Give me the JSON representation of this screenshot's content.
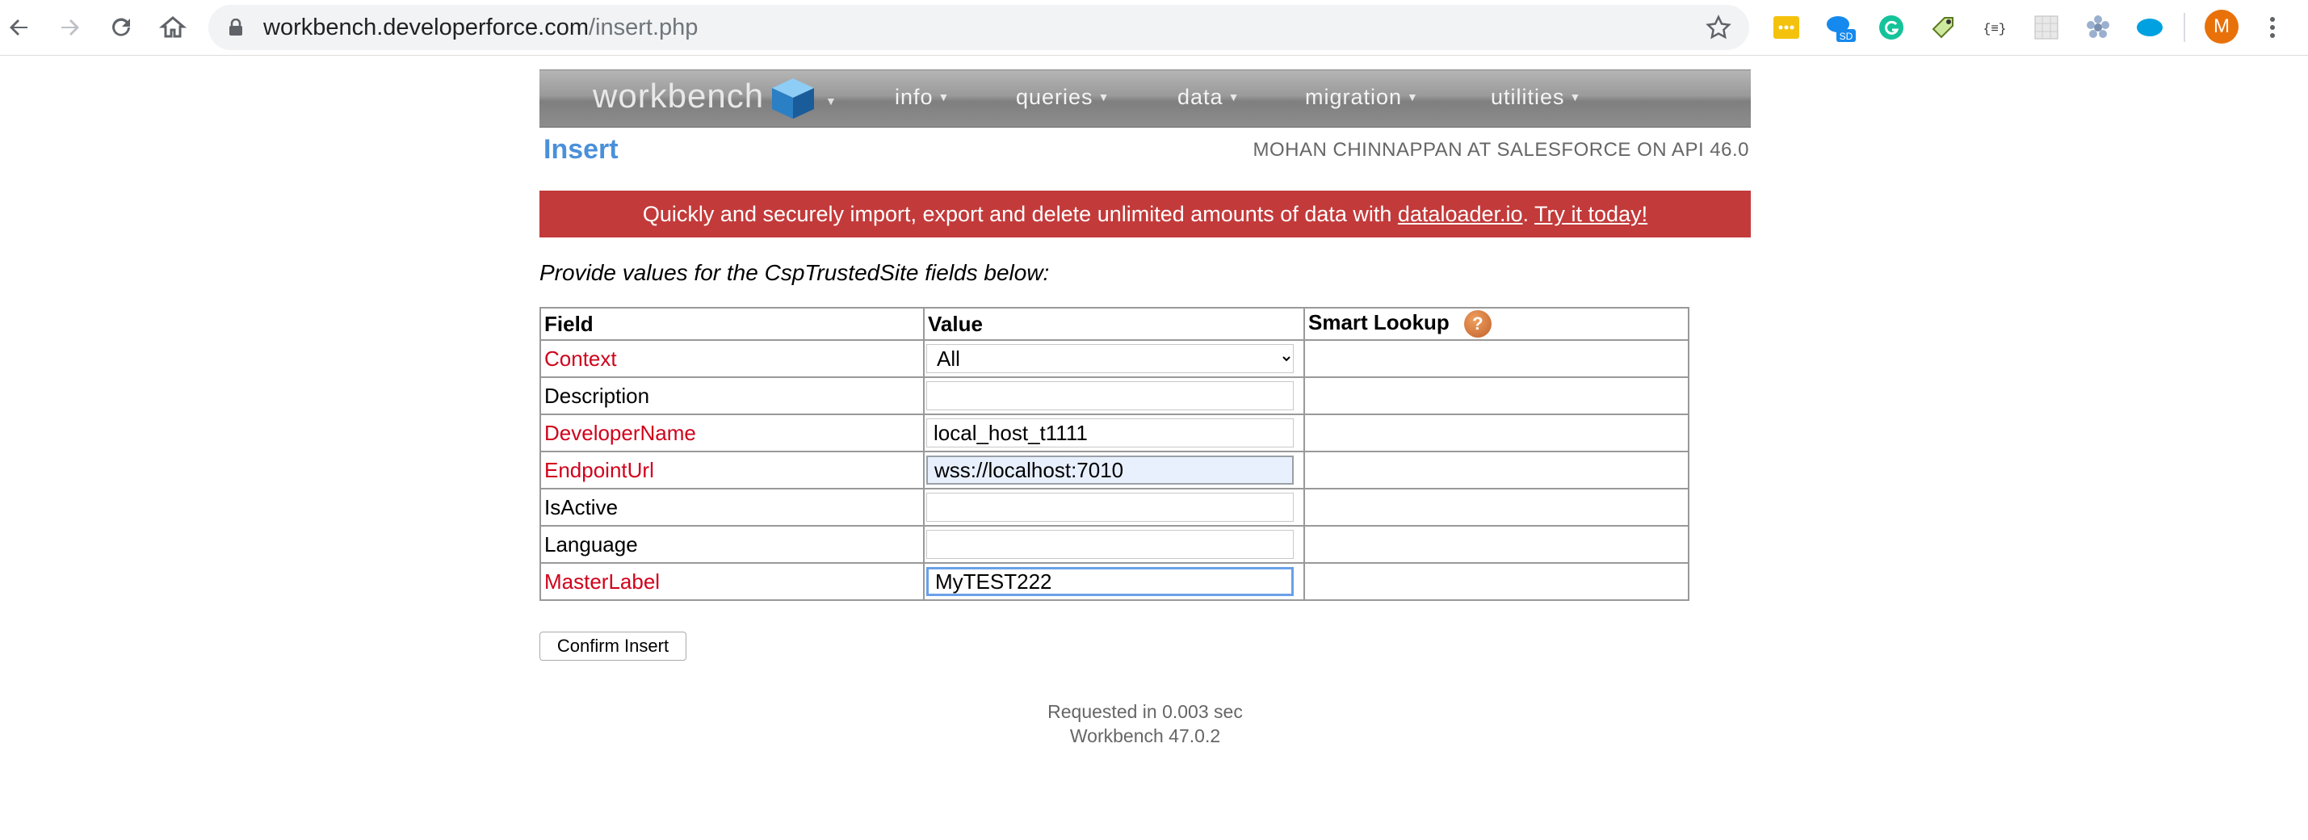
{
  "browser": {
    "url_host": "workbench.developerforce.com",
    "url_path": "/insert.php",
    "avatar_letter": "M",
    "extension_badge": "SD"
  },
  "workbench": {
    "logo_text": "workbench",
    "menu": [
      "info",
      "queries",
      "data",
      "migration",
      "utilities"
    ]
  },
  "page": {
    "title": "Insert",
    "user_info": "MOHAN CHINNAPPAN AT SALESFORCE ON API 46.0"
  },
  "banner": {
    "text": "Quickly and securely import, export and delete unlimited amounts of data with ",
    "link1": "dataloader.io",
    "sep": ". ",
    "link2": "Try it today!"
  },
  "instructions": "Provide values for the CspTrustedSite fields below:",
  "table": {
    "headers": {
      "field": "Field",
      "value": "Value",
      "smart_lookup": "Smart Lookup"
    },
    "rows": [
      {
        "field": "Context",
        "required": true,
        "value": ""
      },
      {
        "field": "Description",
        "required": false,
        "value": ""
      },
      {
        "field": "DeveloperName",
        "required": true,
        "value": "local_host_t1111"
      },
      {
        "field": "EndpointUrl",
        "required": true,
        "value": "wss://localhost:7010"
      },
      {
        "field": "IsActive",
        "required": false,
        "value": ""
      },
      {
        "field": "Language",
        "required": false,
        "value": ""
      },
      {
        "field": "MasterLabel",
        "required": true,
        "value": "MyTEST222"
      }
    ],
    "context_select_value": "All"
  },
  "confirm_label": "Confirm Insert",
  "footer": {
    "line1": "Requested in 0.003 sec",
    "line2": "Workbench 47.0.2"
  },
  "colors": {
    "required": "#d0021b",
    "banner": "#c33a3a",
    "title": "#4a90d9"
  }
}
